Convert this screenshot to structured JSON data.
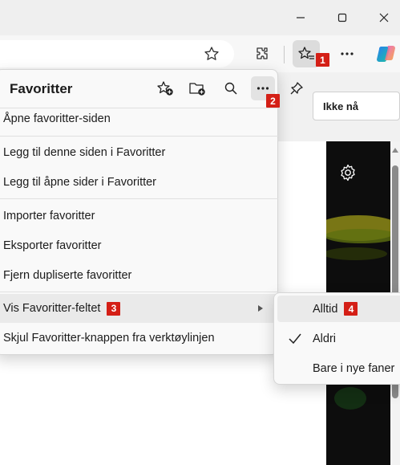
{
  "window": {
    "minimize_icon": "minimize-icon",
    "maximize_icon": "maximize-icon",
    "close_icon": "close-icon"
  },
  "toolbar": {
    "icons": [
      "star-outline-icon",
      "extensions-icon",
      "favorites-icon",
      "more-icon",
      "copilot-icon"
    ]
  },
  "page": {
    "button_label": "Ikke nå"
  },
  "favorites_panel": {
    "title": "Favoritter",
    "header_icons": [
      "add-favorite-icon",
      "add-folder-icon",
      "search-icon",
      "more-options-icon",
      "pin-icon"
    ],
    "items": [
      {
        "label": "Åpne favoritter-siden"
      },
      {
        "label": "Legg til denne siden i Favoritter"
      },
      {
        "label": "Legg til åpne sider i Favoritter"
      },
      {
        "label": "Importer favoritter"
      },
      {
        "label": "Eksporter favoritter"
      },
      {
        "label": "Fjern dupliserte favoritter"
      },
      {
        "label": "Vis Favoritter-feltet",
        "has_submenu": true
      },
      {
        "label": "Skjul Favoritter-knappen fra verktøylinjen"
      }
    ]
  },
  "submenu": {
    "items": [
      {
        "label": "Alltid",
        "checked": false
      },
      {
        "label": "Aldri",
        "checked": true
      },
      {
        "label": "Bare i nye faner",
        "checked": false
      }
    ]
  },
  "badges": {
    "b1": "1",
    "b2": "2",
    "b3": "3",
    "b4": "4"
  },
  "colors": {
    "badge": "#d41f16",
    "panel_bg": "#f9f9f9",
    "highlight": "#eaeaea"
  }
}
